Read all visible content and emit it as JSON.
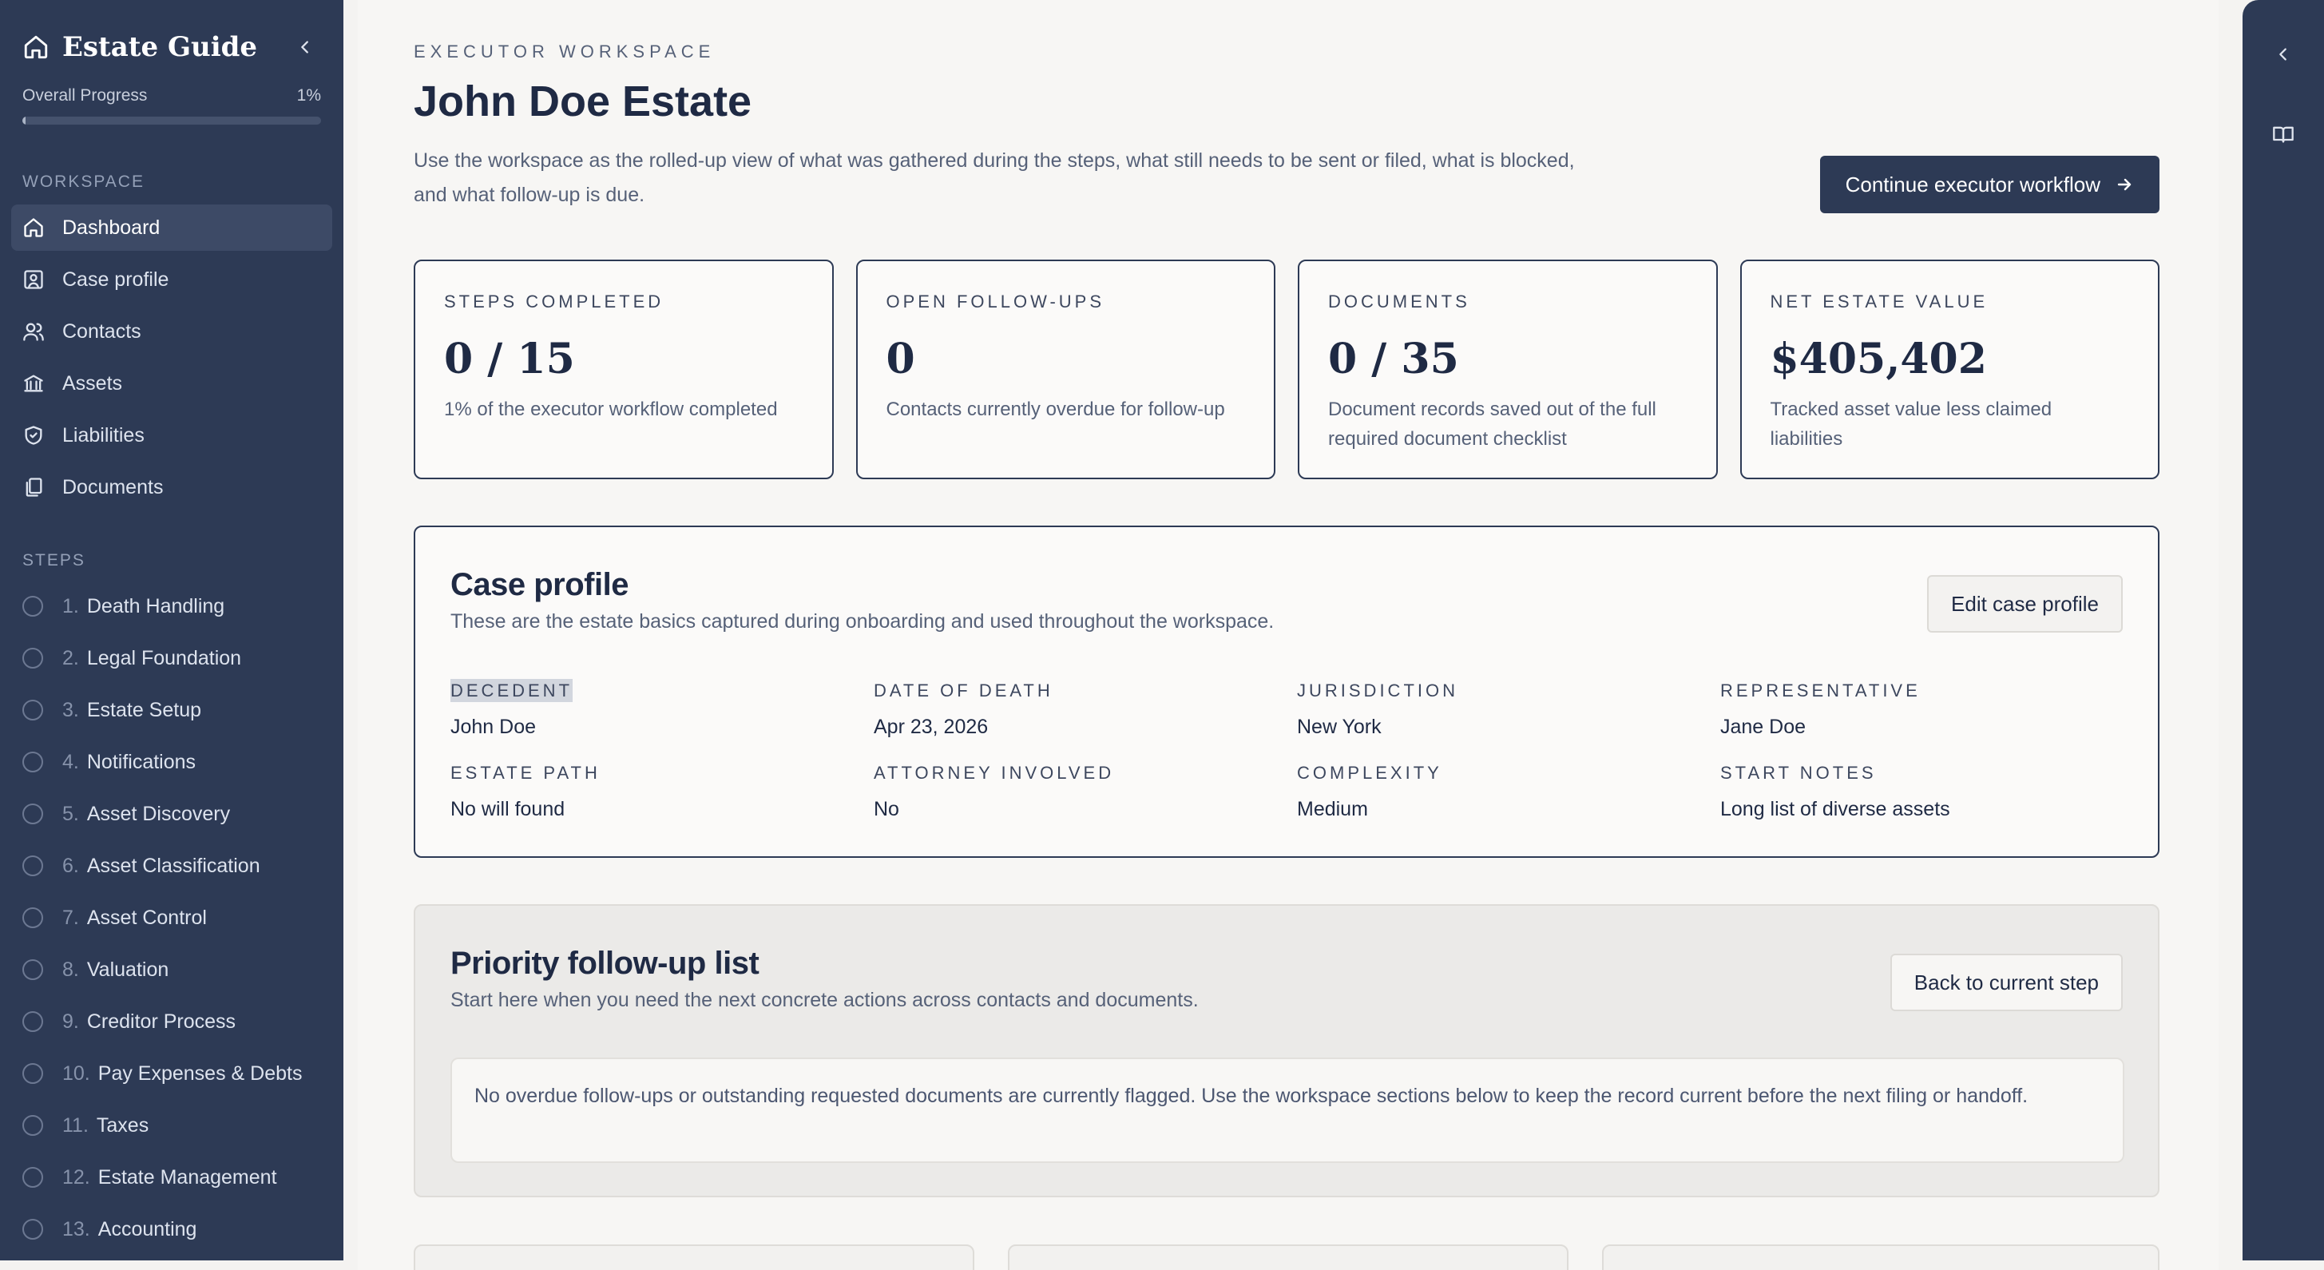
{
  "sidebar": {
    "brand": "Estate Guide",
    "progress_label": "Overall Progress",
    "progress_value": "1%",
    "progress_fraction": 0.01,
    "workspace_label": "WORKSPACE",
    "workspace_items": [
      {
        "label": "Dashboard",
        "icon": "home-icon"
      },
      {
        "label": "Case profile",
        "icon": "profile-icon"
      },
      {
        "label": "Contacts",
        "icon": "users-icon"
      },
      {
        "label": "Assets",
        "icon": "bank-icon"
      },
      {
        "label": "Liabilities",
        "icon": "shield-check-icon"
      },
      {
        "label": "Documents",
        "icon": "documents-icon"
      }
    ],
    "steps_label": "STEPS",
    "steps": [
      {
        "num": "1.",
        "label": "Death Handling"
      },
      {
        "num": "2.",
        "label": "Legal Foundation"
      },
      {
        "num": "3.",
        "label": "Estate Setup"
      },
      {
        "num": "4.",
        "label": "Notifications"
      },
      {
        "num": "5.",
        "label": "Asset Discovery"
      },
      {
        "num": "6.",
        "label": "Asset Classification"
      },
      {
        "num": "7.",
        "label": "Asset Control"
      },
      {
        "num": "8.",
        "label": "Valuation"
      },
      {
        "num": "9.",
        "label": "Creditor Process"
      },
      {
        "num": "10.",
        "label": "Pay Expenses & Debts"
      },
      {
        "num": "11.",
        "label": "Taxes"
      },
      {
        "num": "12.",
        "label": "Estate Management"
      },
      {
        "num": "13.",
        "label": "Accounting"
      }
    ]
  },
  "header": {
    "eyebrow": "EXECUTOR WORKSPACE",
    "title": "John Doe Estate",
    "intro": "Use the workspace as the rolled-up view of what was gathered during the steps, what still needs to be sent or filed, what is blocked, and what follow-up is due.",
    "continue_label": "Continue executor workflow"
  },
  "stats": [
    {
      "label": "STEPS COMPLETED",
      "value": "0 / 15",
      "desc": "1% of the executor workflow completed"
    },
    {
      "label": "OPEN FOLLOW-UPS",
      "value": "0",
      "desc": "Contacts currently overdue for follow-up"
    },
    {
      "label": "DOCUMENTS",
      "value": "0 / 35",
      "desc": "Document records saved out of the full required document checklist"
    },
    {
      "label": "NET ESTATE VALUE",
      "value": "$405,402",
      "desc": "Tracked asset value less claimed liabilities"
    }
  ],
  "case_profile": {
    "title": "Case profile",
    "subtitle": "These are the estate basics captured during onboarding and used throughout the workspace.",
    "edit_label": "Edit case profile",
    "fields": [
      {
        "label": "DECEDENT",
        "value": "John Doe"
      },
      {
        "label": "DATE OF DEATH",
        "value": "Apr 23, 2026"
      },
      {
        "label": "JURISDICTION",
        "value": "New York"
      },
      {
        "label": "REPRESENTATIVE",
        "value": "Jane Doe"
      },
      {
        "label": "ESTATE PATH",
        "value": "No will found"
      },
      {
        "label": "ATTORNEY INVOLVED",
        "value": "No"
      },
      {
        "label": "COMPLEXITY",
        "value": "Medium"
      },
      {
        "label": "START NOTES",
        "value": "Long list of diverse assets"
      }
    ]
  },
  "priority": {
    "title": "Priority follow-up list",
    "subtitle": "Start here when you need the next concrete actions across contacts and documents.",
    "back_label": "Back to current step",
    "notice": "No overdue follow-ups or outstanding requested documents are currently flagged. Use the workspace sections below to keep the record current before the next filing or handoff."
  },
  "rail": {
    "collapse_icon": "chevron-left-icon",
    "guide_icon": "book-icon"
  },
  "colors": {
    "sidebar_bg": "#2d3a55",
    "primary": "#2d3a55",
    "page_bg": "#f7f6f4"
  }
}
